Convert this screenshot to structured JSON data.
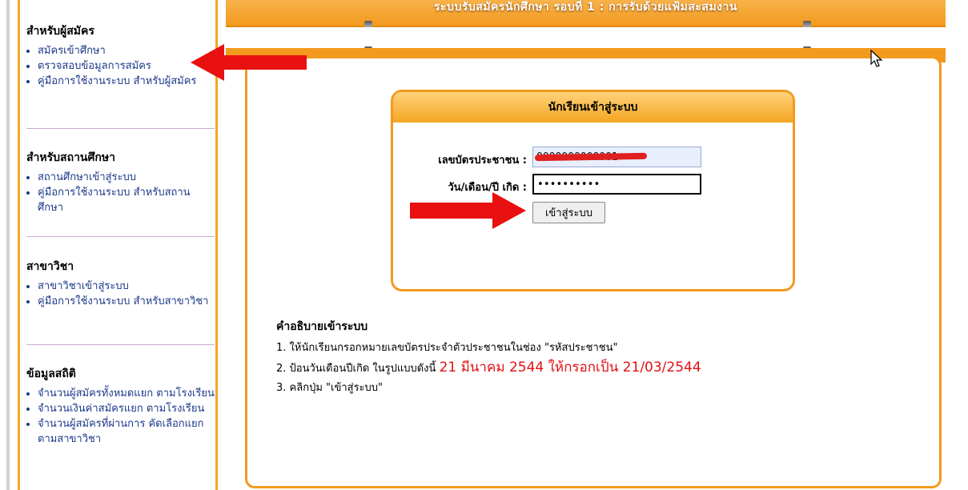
{
  "banner": {
    "title": "ระบบรับสมัครนักศึกษา รอบที่ 1 : การรับด้วยแฟ้มสะสมงาน"
  },
  "sidebar": {
    "applicant": {
      "heading": "สำหรับผู้สมัคร",
      "items": [
        "สมัครเข้าศึกษา",
        "ตรวจสอบข้อมูลการสมัคร",
        "คู่มือการใช้งานระบบ สำหรับผู้สมัคร"
      ]
    },
    "school": {
      "heading": "สำหรับสถานศึกษา",
      "items": [
        "สถานศึกษาเข้าสู่ระบบ",
        "คู่มือการใช้งานระบบ สำหรับสถานศึกษา"
      ]
    },
    "major": {
      "heading": "สาขาวิชา",
      "items": [
        "สาขาวิชาเข้าสู่ระบบ",
        "คู่มือการใช้งานระบบ สำหรับสาขาวิชา"
      ]
    },
    "stats": {
      "heading": "ข้อมูลสถิติ",
      "items": [
        "จำนวนผู้สมัครทั้งหมดแยก ตามโรงเรียน",
        "จำนวนเงินค่าสมัครแยก ตามโรงเรียน",
        "จำนวนผู้สมัครที่ผ่านการ คัดเลือกแยกตามสาขาวิชา"
      ]
    }
  },
  "login": {
    "header": "นักเรียนเข้าสู่ระบบ",
    "id_label": "เลขบัตรประชาชน :",
    "id_value": "0000000000001",
    "date_label": "วัน/เดือน/ปี เกิด :",
    "date_value": "••••••••••",
    "button": "เข้าสู่ระบบ"
  },
  "instructions": {
    "title": "คำอธิบายเข้าระบบ",
    "step1": "1. ให้นักเรียนกรอกหมายเลขบัตรประจำตัวประชาชนในช่อง \"รหัสประชาชน\"",
    "step2_prefix": "2. ป้อนวันเดือนปีเกิด ในรูปแบบดังนี้ ",
    "step2_highlight": "21 มีนาคม 2544 ให้กรอกเป็น 21/03/2544",
    "step3": "3. คลิกปุ่ม \"เข้าสู่ระบบ\""
  },
  "colors": {
    "accent": "#f39a1e",
    "link": "#1d3a8a",
    "annotation_arrow": "#e81010"
  }
}
